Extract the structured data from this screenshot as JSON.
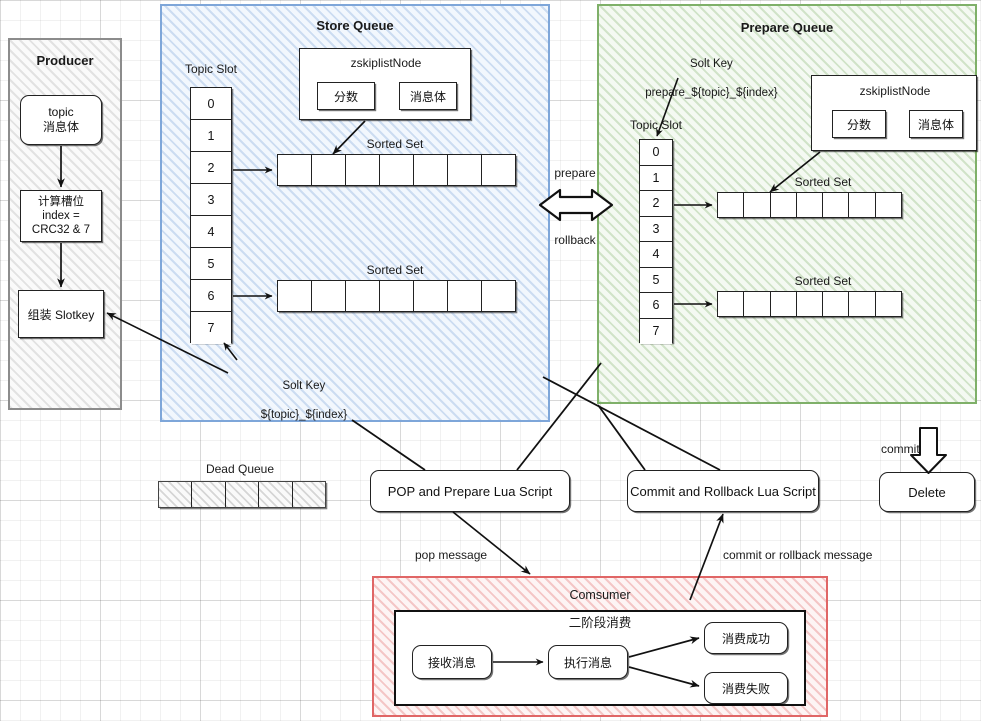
{
  "producer": {
    "title": "Producer",
    "steps": [
      {
        "lines": [
          "topic",
          "消息体"
        ]
      },
      {
        "lines": [
          "计算槽位",
          "index =",
          "CRC32 & 7"
        ]
      },
      {
        "lines": [
          "组装 Slotkey"
        ]
      }
    ]
  },
  "store_queue": {
    "title": "Store Queue",
    "topic_slot_label": "Topic Slot",
    "slots": [
      "0",
      "1",
      "2",
      "3",
      "4",
      "5",
      "6",
      "7"
    ],
    "zskiplist": {
      "title": "zskiplistNode",
      "score_label": "分数",
      "body_label": "消息体"
    },
    "sorted_sets": [
      {
        "label": "Sorted Set",
        "cells": 7,
        "from_slot": "2"
      },
      {
        "label": "Sorted Set",
        "cells": 7,
        "from_slot": "6"
      }
    ],
    "solt_key": {
      "line1": "Solt Key",
      "line2": "${topic}_${index}"
    }
  },
  "prepare_queue": {
    "title": "Prepare Queue",
    "topic_slot_label": "Topic Slot",
    "slots": [
      "0",
      "1",
      "2",
      "3",
      "4",
      "5",
      "6",
      "7"
    ],
    "zskiplist": {
      "title": "zskiplistNode",
      "score_label": "分数",
      "body_label": "消息体"
    },
    "sorted_sets": [
      {
        "label": "Sorted Set",
        "cells": 7,
        "from_slot": "2"
      },
      {
        "label": "Sorted Set",
        "cells": 7,
        "from_slot": "6"
      }
    ],
    "solt_key": {
      "line1": "Solt Key",
      "line2": "prepare_${topic}_${index}"
    }
  },
  "transition": {
    "prepare_label": "prepare",
    "rollback_label": "rollback"
  },
  "dead_queue": {
    "label": "Dead Queue",
    "cells": 5
  },
  "scripts": {
    "pop_prepare": "POP and Prepare Lua Script",
    "commit_rollback": "Commit and Rollback Lua Script",
    "delete": "Delete",
    "commit_label": "commit"
  },
  "edges": {
    "pop_message": "pop message",
    "commit_or_rollback": "commit or rollback message"
  },
  "consumer": {
    "title": "Comsumer",
    "inner_title": "二阶段消费",
    "steps": [
      {
        "label": "接收消息"
      },
      {
        "label": "执行消息"
      }
    ],
    "outcomes": [
      {
        "label": "消费成功"
      },
      {
        "label": "消费失败"
      }
    ]
  },
  "colors": {
    "store_border": "#7ea6d9",
    "prepare_border": "#7fb069",
    "producer_border": "#8c8c8c",
    "consumer_border": "#e06666",
    "stroke": "#222222",
    "grid": "#e8e8e8"
  }
}
